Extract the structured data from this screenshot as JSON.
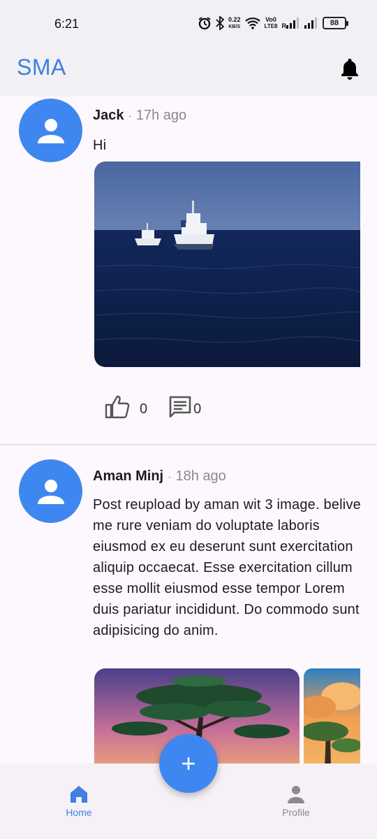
{
  "status_bar": {
    "time": "6:21",
    "net_speed_value": "0.22",
    "net_speed_unit": "KB/S",
    "volte_top": "Vo0",
    "volte_bottom": "LTE8",
    "signal_label": "R",
    "battery": "88"
  },
  "app_bar": {
    "title": "SMA",
    "notification_icon": "bell-icon"
  },
  "posts": [
    {
      "author": "Jack",
      "separator": "·",
      "time": "17h ago",
      "text": "Hi",
      "likes": "0",
      "comments": "0"
    },
    {
      "author": "Aman Minj",
      "separator": "·",
      "time": "18h ago",
      "text": "Post  reupload by aman wit 3 image. belive me rure veniam do voluptate laboris eiusmod ex eu deserunt sunt exercitation aliquip occaecat. Esse exercitation cillum esse mollit eiusmod esse tempor Lorem duis pariatur incididunt. Do commodo sunt adipisicing do anim."
    }
  ],
  "bottom_nav": {
    "home_label": "Home",
    "profile_label": "Profile",
    "fab_label": "+"
  },
  "colors": {
    "accent": "#3f87f0",
    "title": "#3d7fe0",
    "active_nav": "#3f7fe0",
    "inactive_nav": "#8c8a90"
  }
}
